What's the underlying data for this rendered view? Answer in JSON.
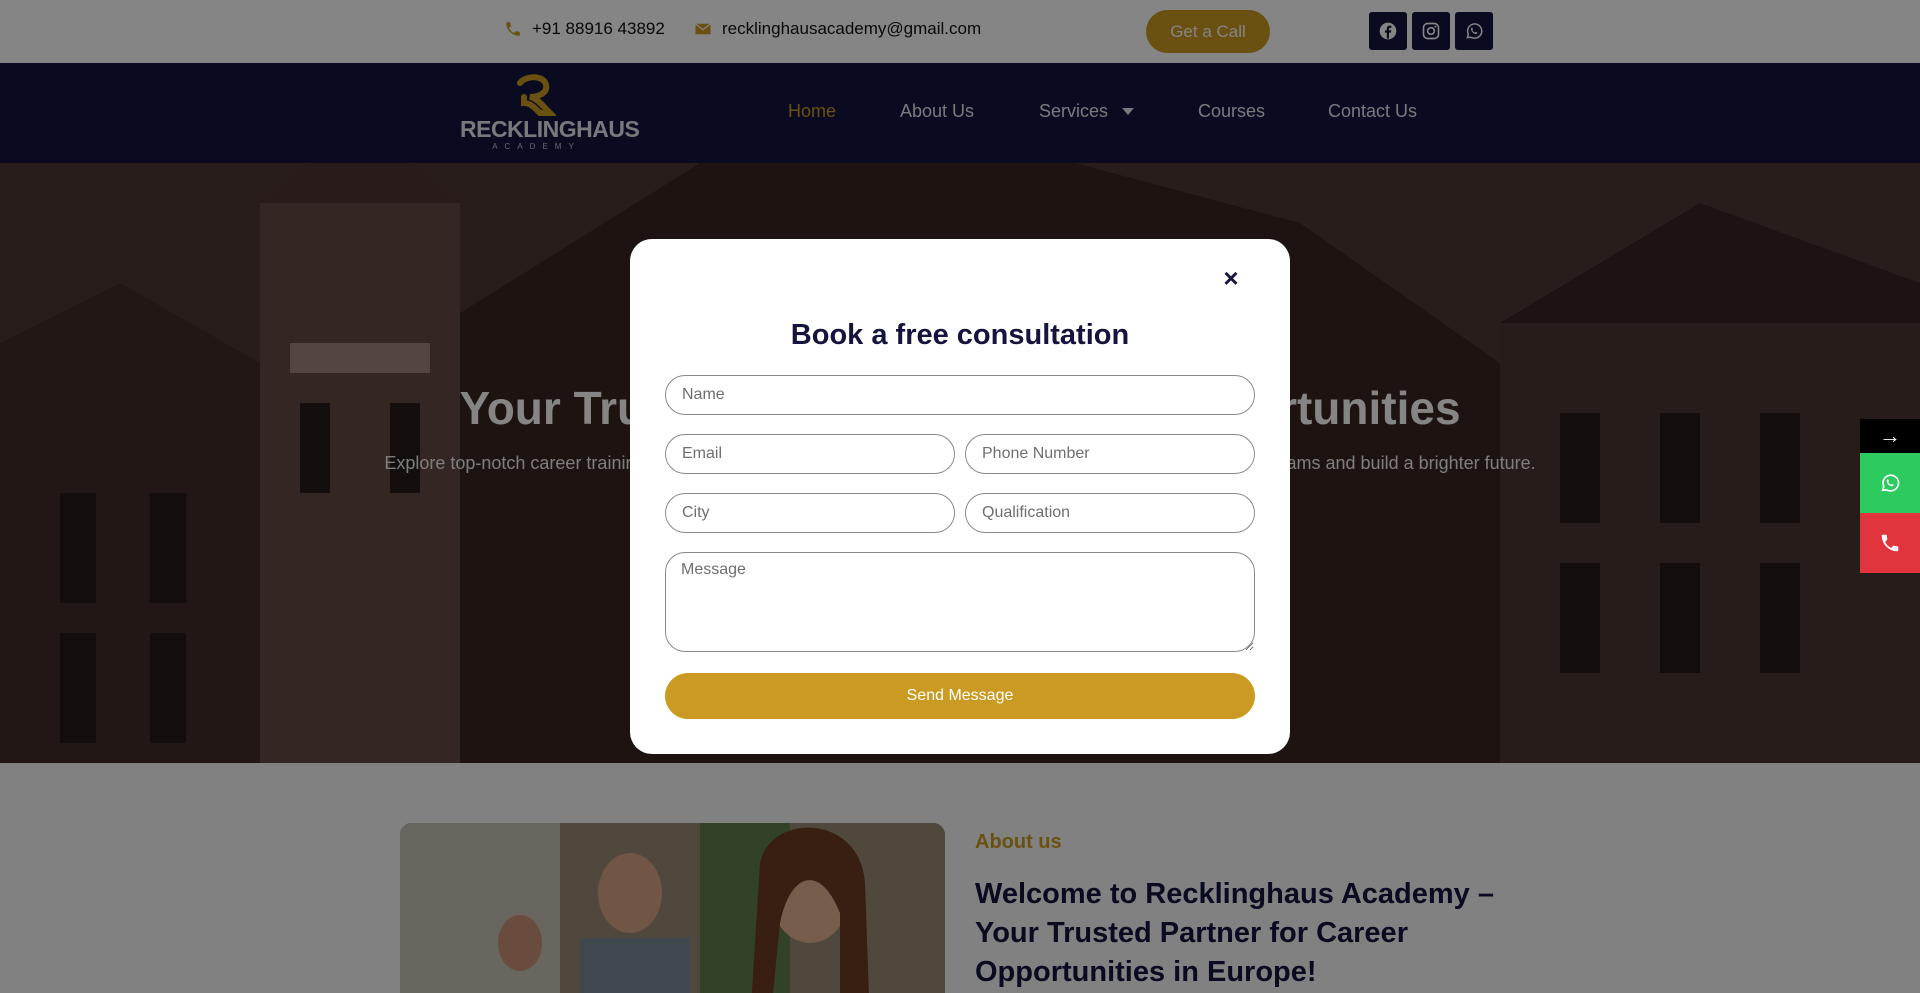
{
  "topbar": {
    "phone": "+91 88916 43892",
    "email": "recklinghausacademy@gmail.com",
    "cta_label": "Get a Call",
    "social_icons": [
      "facebook-icon",
      "instagram-icon",
      "whatsapp-icon"
    ]
  },
  "nav": {
    "logo_text": "RECKLINGHAUS",
    "logo_sub": "ACADEMY",
    "items": [
      {
        "label": "Home",
        "active": true
      },
      {
        "label": "About Us"
      },
      {
        "label": "Services",
        "has_dropdown": true
      },
      {
        "label": "Courses"
      },
      {
        "label": "Contact Us"
      }
    ]
  },
  "hero": {
    "title": "Your Trusted Partner for Career Opportunities",
    "subtitle": "Explore top-notch career training, study programs, and job opportunities in Europe. We help you achieve your dreams and build a brighter future."
  },
  "about": {
    "label": "About us",
    "heading": "Welcome to Recklinghaus Academy – Your Trusted Partner for Career Opportunities in Europe!"
  },
  "side": {
    "arrow": "→",
    "icons": [
      "whatsapp-icon",
      "phone-icon"
    ]
  },
  "modal": {
    "title": "Book a free consultation",
    "close": "×",
    "name_placeholder": "Name",
    "email_placeholder": "Email",
    "phone_placeholder": "Phone Number",
    "city_placeholder": "City",
    "qualification_placeholder": "Qualification",
    "message_placeholder": "Message",
    "submit_label": "Send Message"
  },
  "colors": {
    "brand_navy": "#14143e",
    "brand_gold": "#cb9a22",
    "whatsapp_green": "#2dcb5e",
    "call_red": "#e2343d"
  }
}
